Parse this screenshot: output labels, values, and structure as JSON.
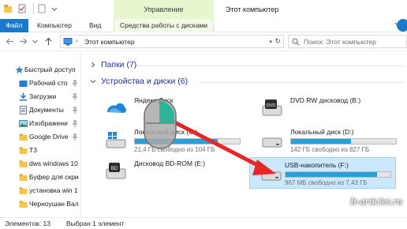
{
  "titlebar": {
    "context_group": "Управление",
    "window_title": "Этот компьютер"
  },
  "ribbon": {
    "tabs": [
      "Файл",
      "Компьютер",
      "Вид",
      "Средства работы с дисками"
    ]
  },
  "address": {
    "path": "Этот компьютер",
    "search_placeholder": "Поиск: Этот компьютер"
  },
  "sidebar": {
    "items": [
      {
        "label": "Быстрый доступ",
        "icon": "star-icon",
        "pinned": false
      },
      {
        "label": "Рабочий сто",
        "icon": "desktop-icon",
        "pinned": true
      },
      {
        "label": "Загрузки",
        "icon": "download-icon",
        "pinned": true
      },
      {
        "label": "Документы",
        "icon": "documents-icon",
        "pinned": true
      },
      {
        "label": "Изображени",
        "icon": "pictures-icon",
        "pinned": true
      },
      {
        "label": "Google Drive",
        "icon": "folder-icon",
        "pinned": true
      },
      {
        "label": "T3",
        "icon": "folder-icon",
        "pinned": false
      },
      {
        "label": "dws windows 10",
        "icon": "folder-icon",
        "pinned": false
      },
      {
        "label": "Буфер для скри",
        "icon": "folder-icon",
        "pinned": false
      },
      {
        "label": "установка win 1",
        "icon": "folder-icon",
        "pinned": false
      },
      {
        "label": "Черноушан Вал",
        "icon": "folder-icon",
        "pinned": false
      }
    ]
  },
  "content": {
    "folders_group": "Папки (7)",
    "devices_group": "Устройства и диски (6)",
    "devices": [
      {
        "name": "Яндекс.Диск",
        "icon": "yandex-disk-icon",
        "has_bar": false,
        "used_fraction": 0,
        "free": "",
        "selected": false
      },
      {
        "name": "DVD RW дисковод (B:)",
        "icon": "dvd-drive-icon",
        "has_bar": false,
        "used_fraction": 0,
        "free": "",
        "selected": false
      },
      {
        "name": "Локальный диск (C:)",
        "icon": "windows-drive-icon",
        "has_bar": true,
        "used_fraction": 0.79,
        "free": "21,4 ГБ свободно из 104 ГБ",
        "selected": false
      },
      {
        "name": "Локальный диск (D:)",
        "icon": "hard-drive-icon",
        "has_bar": true,
        "used_fraction": 0.57,
        "free": "142 ГБ свободно из 827 ГБ",
        "selected": false
      },
      {
        "name": "Дисковод BD-ROM (E:)",
        "icon": "bd-drive-icon",
        "has_bar": false,
        "used_fraction": 0,
        "free": "",
        "selected": false
      },
      {
        "name": "USB-накопитель (F:)",
        "icon": "usb-drive-icon",
        "has_bar": true,
        "used_fraction": 0.87,
        "free": "967 МБ свободно из 7,43 ГБ",
        "selected": true
      }
    ]
  },
  "status": {
    "count": "Элементов: 13",
    "selected": "Выбран 1 элемент"
  },
  "watermark": "It-articles.ru",
  "colors": {
    "accent": "#1979ca",
    "context_band": "#e6f6cf",
    "selection": "#cce8ff",
    "bar_fill": "#26a0da",
    "arrow": "#e8262a",
    "group_title": "#1e3287"
  }
}
